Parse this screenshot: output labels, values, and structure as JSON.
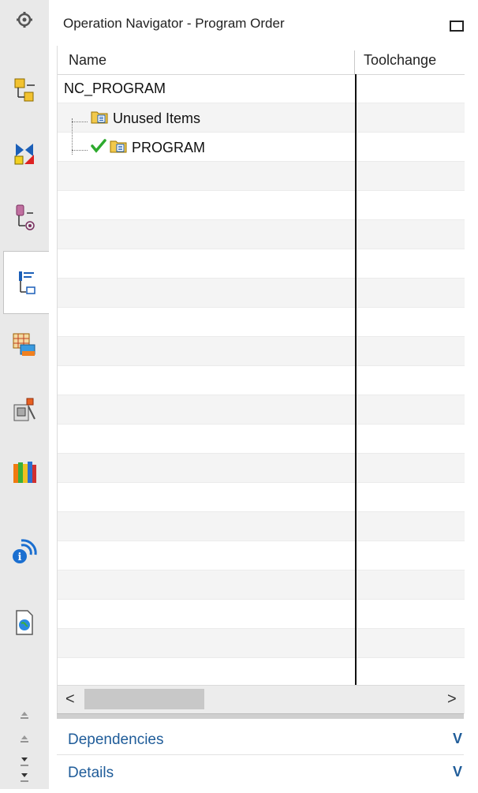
{
  "panel": {
    "title": "Operation Navigator - Program Order",
    "columns": [
      "Name",
      "Toolchange"
    ]
  },
  "tree": {
    "root": "NC_PROGRAM",
    "children": [
      "Unused Items",
      "PROGRAM"
    ]
  },
  "sections": {
    "dependencies": "Dependencies",
    "details": "Details",
    "chevron": "V"
  },
  "scroll": {
    "left": "<",
    "right": ">"
  },
  "resource_bar": {
    "icons": [
      "settings-gear-icon",
      "assembly-navigator-icon",
      "constraint-navigator-icon",
      "part-navigator-icon",
      "operation-navigator-icon",
      "machine-tool-navigator-icon",
      "machining-feature-navigator-icon",
      "reuse-library-icon",
      "info-broadcast-icon",
      "web-browser-icon"
    ]
  },
  "colors": {
    "link": "#1f5c99",
    "check": "#2eaa2e",
    "folder": "#f2c94c"
  }
}
